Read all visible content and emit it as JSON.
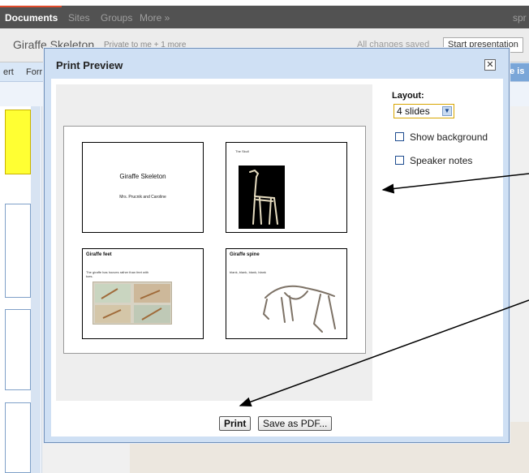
{
  "topbar": {
    "nav": [
      "Documents",
      "Sites",
      "Groups",
      "More »"
    ],
    "user": "spr"
  },
  "document": {
    "title": "Giraffe Skeleton",
    "sharing": "Private to me + 1 more",
    "save_status": "All changes saved",
    "start_presentation": "Start presentation"
  },
  "menubar": {
    "items": [
      "ert",
      "Forr"
    ],
    "right_badge": "se is"
  },
  "dialog": {
    "title": "Print Preview",
    "close_label": "✕",
    "layout_label": "Layout:",
    "layout_value": "4 slides",
    "show_background": "Show background",
    "speaker_notes": "Speaker notes",
    "print_button": "Print",
    "save_pdf_button": "Save as PDF..."
  },
  "slides": [
    {
      "title": "Giraffe Skeleton",
      "subtitle": "Mrs. Prucnik and Caroline"
    },
    {
      "title": "The Skull"
    },
    {
      "title": "Giraffe feet",
      "body": "The giraffe has hooves rather than feet with toes."
    },
    {
      "title": "Giraffe spine",
      "body": "blank, blank, blank, blank"
    }
  ]
}
